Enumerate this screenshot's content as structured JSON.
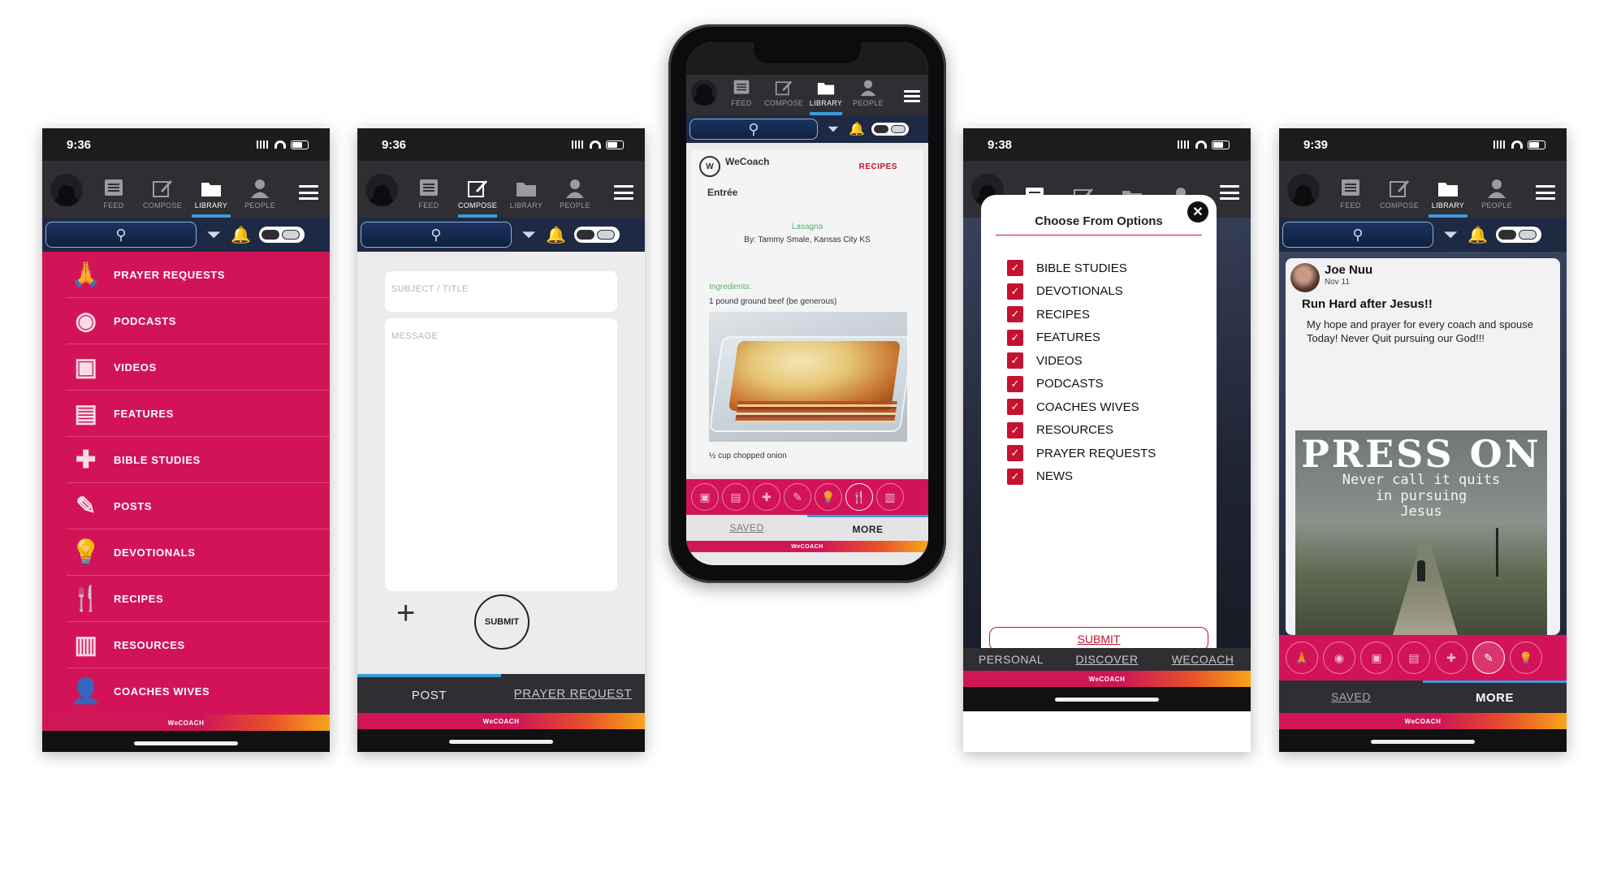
{
  "nav": {
    "feed": "FEED",
    "compose": "COMPOSE",
    "library": "LIBRARY",
    "people": "PEOPLE"
  },
  "brand": "WeCOACH",
  "phone1": {
    "time": "9:36",
    "items": [
      {
        "label": "PRAYER REQUESTS",
        "icon": "praying-hands-icon",
        "glyph": "🙏"
      },
      {
        "label": "PODCASTS",
        "icon": "podcast-icon",
        "glyph": "◉"
      },
      {
        "label": "VIDEOS",
        "icon": "video-icon",
        "glyph": "▣"
      },
      {
        "label": "FEATURES",
        "icon": "document-icon",
        "glyph": "▤"
      },
      {
        "label": "BIBLE STUDIES",
        "icon": "bible-icon",
        "glyph": "✚"
      },
      {
        "label": "POSTS",
        "icon": "posts-icon",
        "glyph": "✎"
      },
      {
        "label": "DEVOTIONALS",
        "icon": "lightbulb-icon",
        "glyph": "💡"
      },
      {
        "label": "RECIPES",
        "icon": "utensils-icon",
        "glyph": "🍴"
      },
      {
        "label": "RESOURCES",
        "icon": "resources-icon",
        "glyph": "▥"
      },
      {
        "label": "COACHES WIVES",
        "icon": "woman-icon",
        "glyph": "👤"
      }
    ]
  },
  "phone2": {
    "time": "9:36",
    "subject_placeholder": "SUBJECT / TITLE",
    "message_placeholder": "MESSAGE",
    "submit": "SUBMIT",
    "tab_post": "POST",
    "tab_prayer": "PRAYER REQUEST"
  },
  "phone3": {
    "org": "WeCoach",
    "category": "RECIPES",
    "entree": "Entrée",
    "dish": "Lasagna",
    "by": "By: Tammy Smale, Kansas City KS",
    "ingredients_label": "Ingredients:",
    "ingredient_1": "1 pound ground beef (be generous)",
    "ingredient_2": "½ cup chopped onion",
    "tab_saved": "SAVED",
    "tab_more": "MORE"
  },
  "phone4": {
    "time": "9:38",
    "modal_title": "Choose From Options",
    "options": [
      "BIBLE STUDIES",
      "DEVOTIONALS",
      "RECIPES",
      "FEATURES",
      "VIDEOS",
      "PODCASTS",
      "COACHES WIVES",
      "RESOURCES",
      "PRAYER REQUESTS",
      "NEWS"
    ],
    "submit": "SUBMIT",
    "tab_personal": "PERSONAL",
    "tab_discover": "DISCOVER",
    "tab_wecoach": "WECOACH"
  },
  "phone5": {
    "time": "9:39",
    "author": "Joe Nuu",
    "date": "Nov 11",
    "title": "Run Hard after Jesus!!",
    "body": "My hope and prayer for every coach and spouse Today! Never Quit pursuing our God!!!",
    "image_headline": "PRESS ON",
    "image_sub": "Never call it quits\nin pursuing\nJesus",
    "tab_saved": "SAVED",
    "tab_more": "MORE"
  }
}
